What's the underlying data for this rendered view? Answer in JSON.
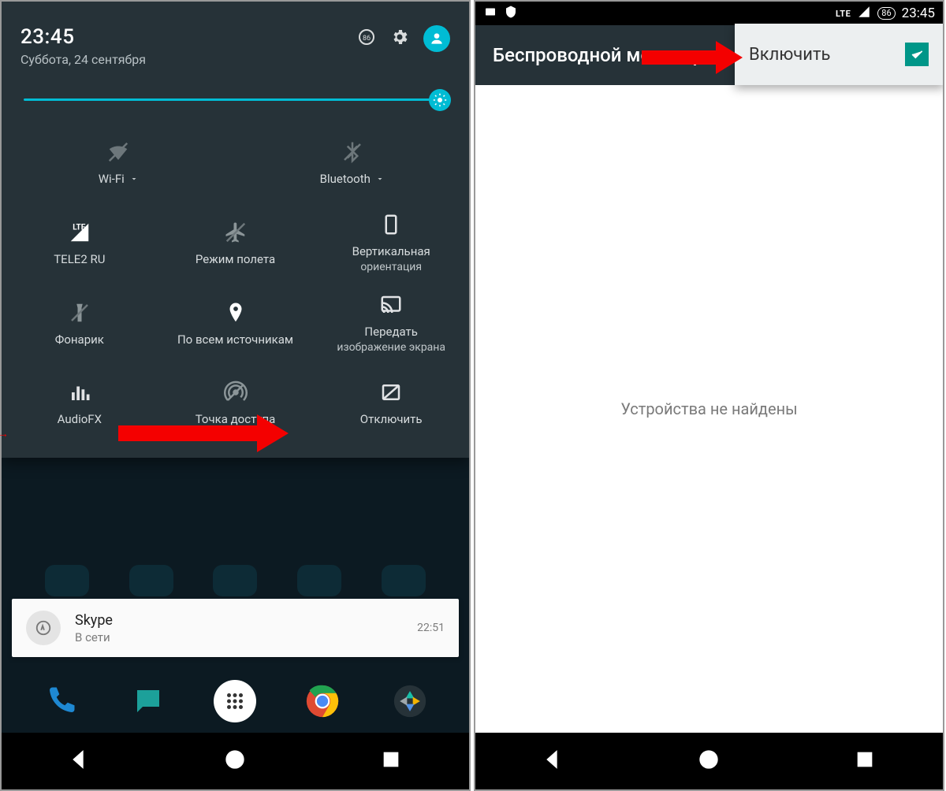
{
  "left": {
    "time": "23:45",
    "date": "Суббота, 24 сентября",
    "battery_percent": "86",
    "tiles_main": [
      {
        "label": "Wi-Fi",
        "icon": "wifi-icon"
      },
      {
        "label": "Bluetooth",
        "icon": "bluetooth-icon"
      }
    ],
    "tiles": [
      {
        "label": "TELE2 RU",
        "icon": "signal-lte-icon"
      },
      {
        "label": "Режим полета",
        "icon": "airplane-icon"
      },
      {
        "label": "Вертикальная",
        "sub": "ориентация",
        "icon": "portrait-icon"
      },
      {
        "label": "Фонарик",
        "icon": "flashlight-icon"
      },
      {
        "label": "По всем источникам",
        "icon": "location-icon"
      },
      {
        "label": "Передать",
        "sub": "изображение экрана",
        "icon": "cast-icon"
      },
      {
        "label": "AudioFX",
        "icon": "equalizer-icon"
      },
      {
        "label": "Точка доступа",
        "icon": "hotspot-icon"
      },
      {
        "label": "Отключить",
        "icon": "screen-off-icon"
      }
    ],
    "notification": {
      "app": "Skype",
      "text": "В сети",
      "time": "22:51"
    }
  },
  "right": {
    "status_time": "23:45",
    "battery_percent": "86",
    "lte": "LTE",
    "title": "Беспроводной монитор",
    "enable_label": "Включить",
    "empty_text": "Устройства не найдены"
  }
}
